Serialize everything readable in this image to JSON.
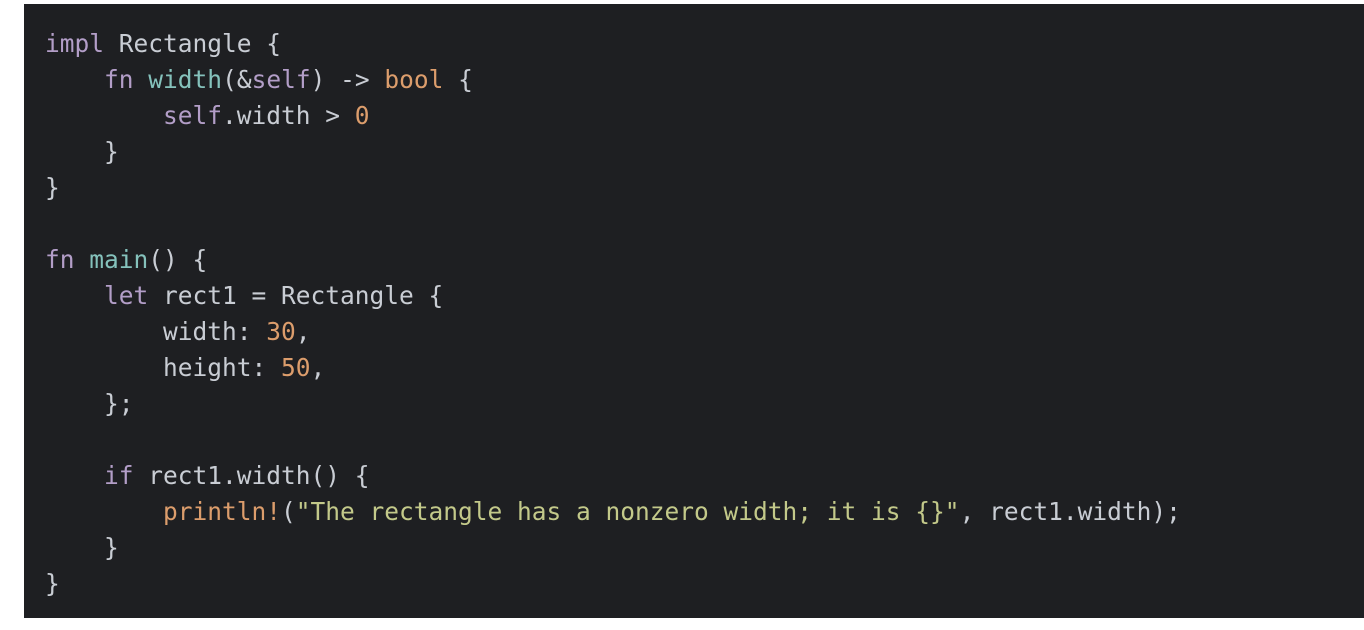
{
  "code": {
    "language": "rust",
    "lines": [
      [
        {
          "t": "impl",
          "c": "keyword"
        },
        {
          "t": " Rectangle {",
          "c": "plain"
        }
      ],
      [
        {
          "t": "    ",
          "c": "plain"
        },
        {
          "t": "fn",
          "c": "keyword"
        },
        {
          "t": " ",
          "c": "plain"
        },
        {
          "t": "width",
          "c": "function"
        },
        {
          "t": "(&",
          "c": "plain"
        },
        {
          "t": "self",
          "c": "self"
        },
        {
          "t": ") -> ",
          "c": "plain"
        },
        {
          "t": "bool",
          "c": "type"
        },
        {
          "t": " {",
          "c": "plain"
        }
      ],
      [
        {
          "t": "        ",
          "c": "plain"
        },
        {
          "t": "self",
          "c": "self"
        },
        {
          "t": ".width > ",
          "c": "plain"
        },
        {
          "t": "0",
          "c": "number"
        }
      ],
      [
        {
          "t": "    }",
          "c": "plain"
        }
      ],
      [
        {
          "t": "}",
          "c": "plain"
        }
      ],
      [],
      [
        {
          "t": "fn",
          "c": "keyword"
        },
        {
          "t": " ",
          "c": "plain"
        },
        {
          "t": "main",
          "c": "function"
        },
        {
          "t": "() {",
          "c": "plain"
        }
      ],
      [
        {
          "t": "    ",
          "c": "plain"
        },
        {
          "t": "let",
          "c": "keyword"
        },
        {
          "t": " rect1 = Rectangle {",
          "c": "plain"
        }
      ],
      [
        {
          "t": "        width: ",
          "c": "plain"
        },
        {
          "t": "30",
          "c": "number"
        },
        {
          "t": ",",
          "c": "plain"
        }
      ],
      [
        {
          "t": "        height: ",
          "c": "plain"
        },
        {
          "t": "50",
          "c": "number"
        },
        {
          "t": ",",
          "c": "plain"
        }
      ],
      [
        {
          "t": "    };",
          "c": "plain"
        }
      ],
      [],
      [
        {
          "t": "    ",
          "c": "plain"
        },
        {
          "t": "if",
          "c": "keyword"
        },
        {
          "t": " rect1.width() {",
          "c": "plain"
        }
      ],
      [
        {
          "t": "        ",
          "c": "plain"
        },
        {
          "t": "println!",
          "c": "macro"
        },
        {
          "t": "(",
          "c": "plain"
        },
        {
          "t": "\"The rectangle has a nonzero width; it is {}\"",
          "c": "string"
        },
        {
          "t": ", rect1.width);",
          "c": "plain"
        }
      ],
      [
        {
          "t": "    }",
          "c": "plain"
        }
      ],
      [
        {
          "t": "}",
          "c": "plain"
        }
      ]
    ]
  },
  "theme": {
    "background": "#1e1f22",
    "plain": "#c9cdd4",
    "keyword": "#b39ec8",
    "function": "#85c2bc",
    "self": "#b39ec8",
    "type": "#dc9d6c",
    "number": "#dc9d6c",
    "macro": "#dc9d6c",
    "string": "#c3c98a"
  }
}
